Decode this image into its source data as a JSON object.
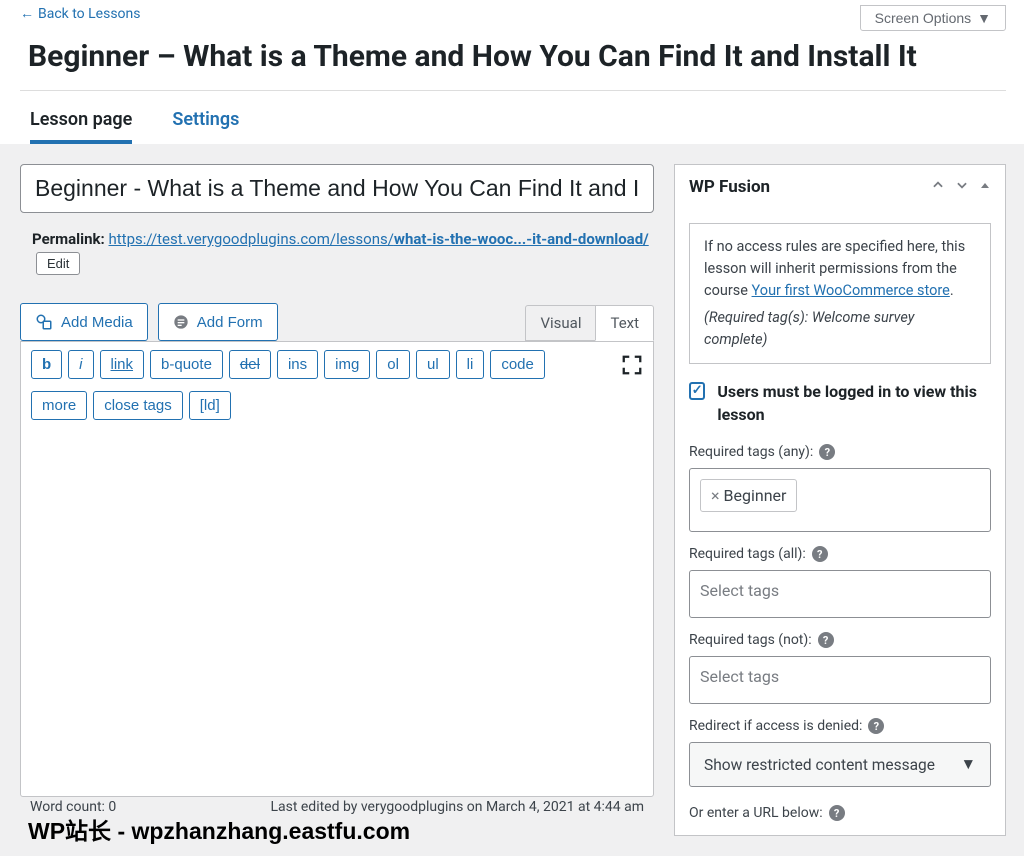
{
  "back_link": "Back to Lessons",
  "screen_options": "Screen Options",
  "page_title": "Beginner – What is a Theme and How You Can Find It and Install It",
  "tabs": {
    "lesson": "Lesson page",
    "settings": "Settings"
  },
  "title_input_value": "Beginner - What is a Theme and How You Can Find It and Install It",
  "permalink": {
    "label": "Permalink:",
    "base": "https://test.verygoodplugins.com/lessons/",
    "slug": "what-is-the-wooc...-it-and-download/",
    "edit": "Edit"
  },
  "media": {
    "add_media": "Add Media",
    "add_form": "Add Form"
  },
  "editor_modes": {
    "visual": "Visual",
    "text": "Text"
  },
  "quicktags": [
    "b",
    "i",
    "link",
    "b-quote",
    "del",
    "ins",
    "img",
    "ol",
    "ul",
    "li",
    "code",
    "more",
    "close tags",
    "[ld]"
  ],
  "footer": {
    "wc_label": "Word count: ",
    "wc_value": "0",
    "last_edit": "Last edited by verygoodplugins on March 4, 2021 at 4:44 am"
  },
  "metabox": {
    "title": "WP Fusion",
    "notice_pre": "If no access rules are specified here, this lesson will inherit permissions from the course ",
    "notice_link": "Your first WooCommerce store",
    "notice_post": ".",
    "required_note": "(Required tag(s): Welcome survey complete)",
    "logged_in_label": "Users must be logged in to view this lesson",
    "req_any_label": "Required tags (any):",
    "req_any_tag": "Beginner",
    "req_all_label": "Required tags (all):",
    "req_not_label": "Required tags (not):",
    "select_tags_placeholder": "Select tags",
    "redirect_label": "Redirect if access is denied:",
    "redirect_value": "Show restricted content message",
    "url_label": "Or enter a URL below:"
  },
  "watermark": "WP站长 - wpzhanzhang.eastfu.com"
}
